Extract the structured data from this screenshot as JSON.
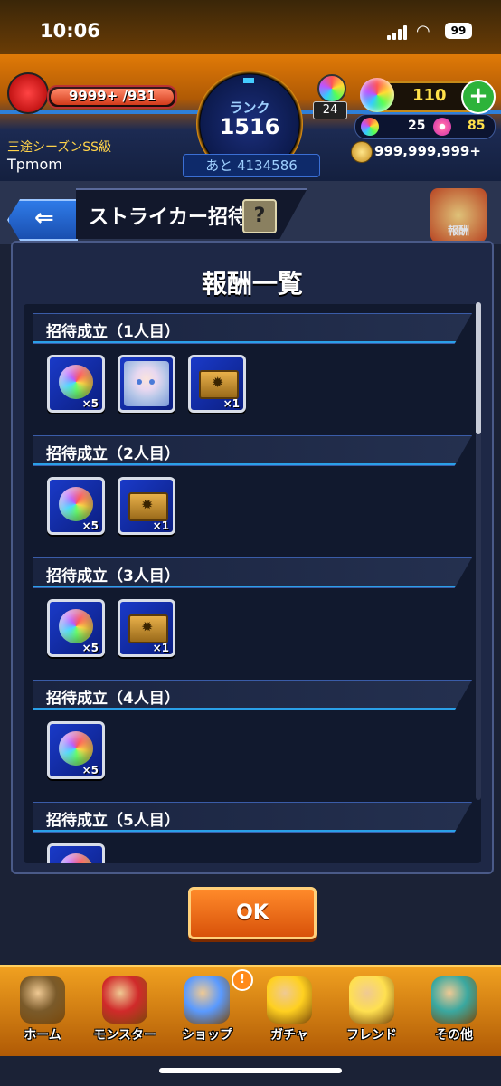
{
  "status_bar": {
    "time": "10:06",
    "battery": "99"
  },
  "header": {
    "stamina": "9999+ /931",
    "stamina_fraction": 1.0,
    "rank_label": "ランク",
    "rank": "1516",
    "next_rank": "あと 4134586",
    "trophy_count": "24",
    "orbs": "110",
    "plus_label": "+",
    "small_orbs": "25",
    "flowers": "85",
    "gold": "999,999,999+",
    "season_rank": "三途シーズンSS級",
    "player_name": "Tpmom"
  },
  "subheader": {
    "back_icon": "back-arrow-icon",
    "back_glyph": "⇐",
    "title": "ストライカー招待",
    "help_label": "?",
    "side_badge": "報酬"
  },
  "modal": {
    "title": "報酬一覧",
    "sections": [
      {
        "label": "招待成立（1人目）",
        "items": [
          {
            "type": "orb",
            "qty": "×5"
          },
          {
            "type": "character",
            "qty": ""
          },
          {
            "type": "ticket",
            "qty": "×1"
          }
        ]
      },
      {
        "label": "招待成立（2人目）",
        "items": [
          {
            "type": "orb",
            "qty": "×5"
          },
          {
            "type": "ticket",
            "qty": "×1"
          }
        ]
      },
      {
        "label": "招待成立（3人目）",
        "items": [
          {
            "type": "orb",
            "qty": "×5"
          },
          {
            "type": "ticket",
            "qty": "×1"
          }
        ]
      },
      {
        "label": "招待成立（4人目）",
        "items": [
          {
            "type": "orb",
            "qty": "×5"
          }
        ]
      },
      {
        "label": "招待成立（5人目）",
        "items": [
          {
            "type": "orb",
            "qty": ""
          }
        ]
      }
    ],
    "ok_label": "OK"
  },
  "bottom_nav": [
    {
      "label": "ホーム",
      "icon": "home-icon",
      "color": "#7a5a2a"
    },
    {
      "label": "モンスター",
      "icon": "monster-icon",
      "color": "#d02a2a"
    },
    {
      "label": "ショップ",
      "icon": "shop-orb-icon",
      "color": "#5a9aff",
      "badge": "!"
    },
    {
      "label": "ガチャ",
      "icon": "gacha-egg-icon",
      "color": "#ffd020"
    },
    {
      "label": "フレンド",
      "icon": "friend-icon",
      "color": "#ffe050"
    },
    {
      "label": "その他",
      "icon": "other-icon",
      "color": "#3aa8a0"
    }
  ]
}
